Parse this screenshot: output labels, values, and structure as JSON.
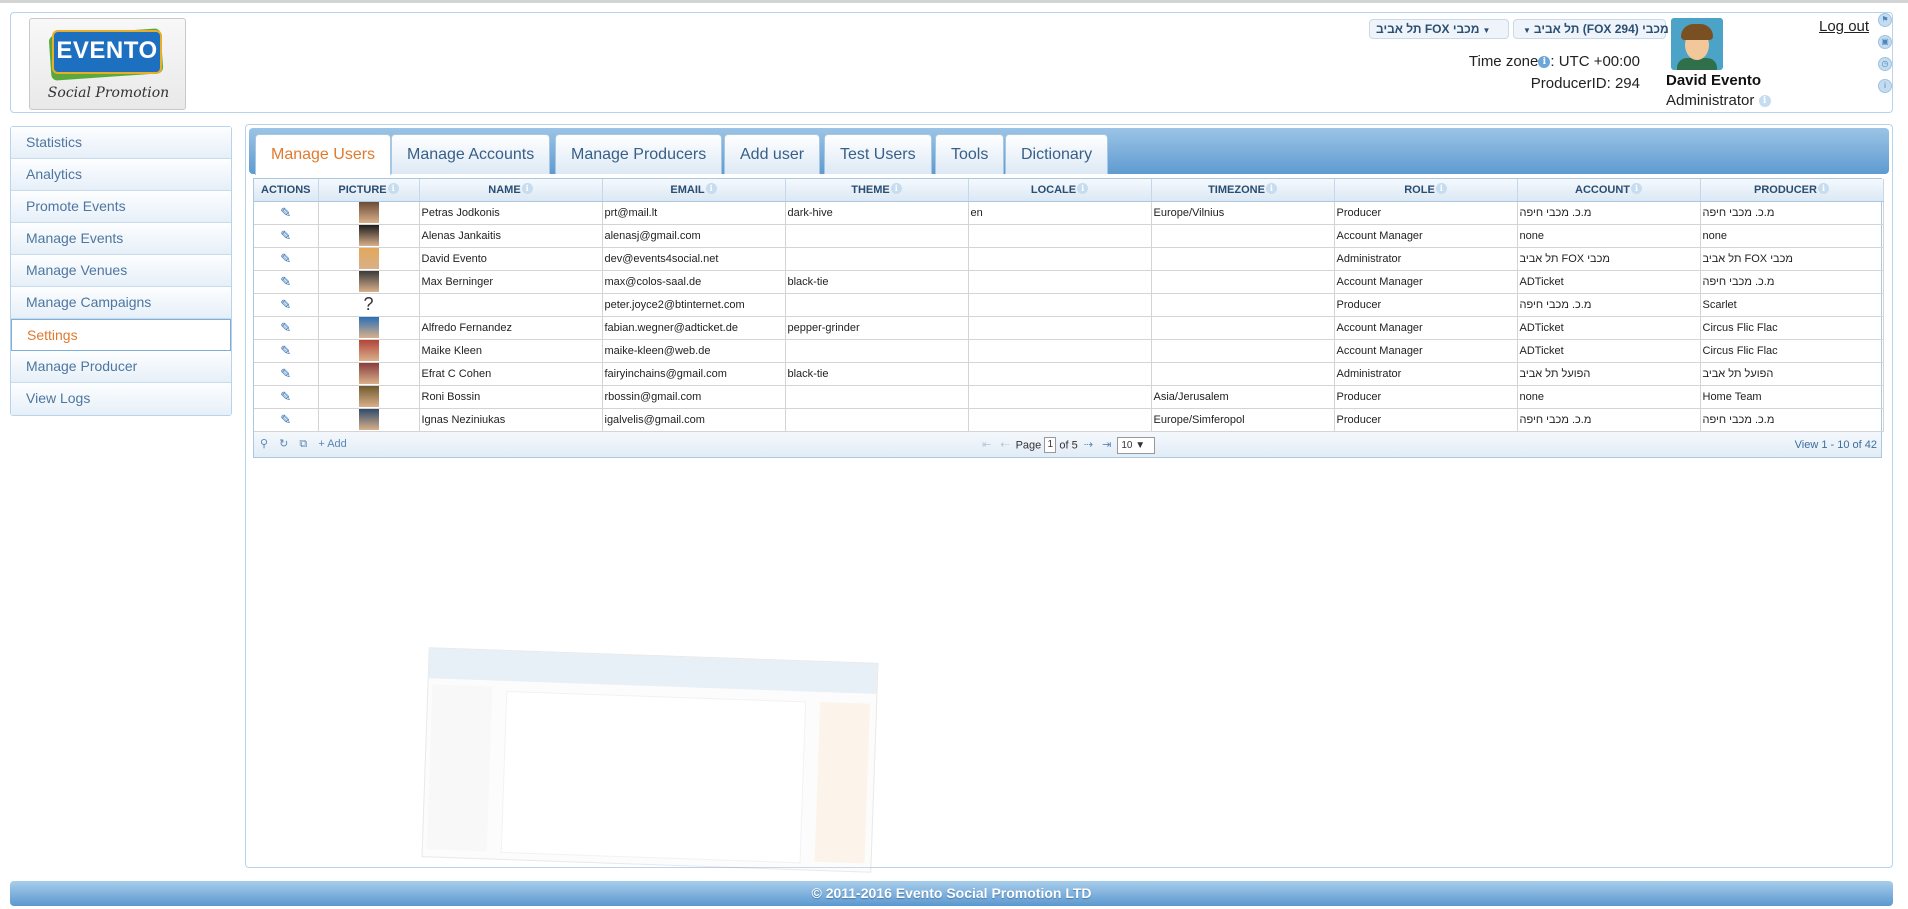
{
  "header": {
    "logo": {
      "title": "EVENTO",
      "subtitle": "Social Promotion"
    },
    "producer_select": "תל אביב (FOX 294) מכבי",
    "account_select": "תל אביב FOX מכבי",
    "timezone_label": "Time zone",
    "timezone_value": ": UTC +00:00",
    "producer_id": "ProducerID: 294",
    "user_name": "David Evento",
    "user_role": "Administrator",
    "logout": "Log out"
  },
  "nav": {
    "items": [
      {
        "label": "Statistics"
      },
      {
        "label": "Analytics"
      },
      {
        "label": "Promote Events"
      },
      {
        "label": "Manage Events"
      },
      {
        "label": "Manage Venues"
      },
      {
        "label": "Manage Campaigns"
      },
      {
        "label": "Settings",
        "active": true
      },
      {
        "label": "Manage Producer"
      },
      {
        "label": "View Logs"
      }
    ]
  },
  "tabs": [
    {
      "label": "Manage Users",
      "active": true
    },
    {
      "label": "Manage Accounts"
    },
    {
      "label": "Manage Producers"
    },
    {
      "label": "Add user"
    },
    {
      "label": "Test Users"
    },
    {
      "label": "Tools"
    },
    {
      "label": "Dictionary"
    }
  ],
  "table": {
    "columns": [
      "ACTIONS",
      "PICTURE",
      "NAME",
      "EMAIL",
      "THEME",
      "LOCALE",
      "TIMEZONE",
      "ROLE",
      "ACCOUNT",
      "PRODUCER"
    ],
    "rows": [
      {
        "name": "Petras Jodkonis",
        "email": "prt@mail.lt",
        "theme": "dark-hive",
        "locale": "en",
        "timezone": "Europe/Vilnius",
        "role": "Producer",
        "account": "מ.כ. מכבי חיפה",
        "producer": "מ.כ. מכבי חיפה",
        "pic": "#6b4b35"
      },
      {
        "name": "Alenas Jankaitis",
        "email": "alenasj@gmail.com",
        "theme": "",
        "locale": "",
        "timezone": "",
        "role": "Account Manager",
        "account": "none",
        "producer": "none",
        "pic": "#1d1d1d"
      },
      {
        "name": "David Evento",
        "email": "dev@events4social.net",
        "theme": "",
        "locale": "",
        "timezone": "",
        "role": "Administrator",
        "account": "תל אביב FOX מכבי",
        "producer": "תל אביב FOX מכבי",
        "pic": "#e2a85a"
      },
      {
        "name": "Max Berninger",
        "email": "max@colos-saal.de",
        "theme": "black-tie",
        "locale": "",
        "timezone": "",
        "role": "Account Manager",
        "account": "ADTicket",
        "producer": "מ.כ. מכבי חיפה",
        "pic": "#3a3a3a"
      },
      {
        "name": "",
        "email": "peter.joyce2@btinternet.com",
        "theme": "",
        "locale": "",
        "timezone": "",
        "role": "Producer",
        "account": "מ.כ. מכבי חיפה",
        "producer": "Scarlet",
        "pic": "?"
      },
      {
        "name": "Alfredo Fernandez",
        "email": "fabian.wegner@adticket.de",
        "theme": "pepper-grinder",
        "locale": "",
        "timezone": "",
        "role": "Account Manager",
        "account": "ADTicket",
        "producer": "Circus Flic Flac",
        "pic": "#2a6fb5"
      },
      {
        "name": "Maike Kleen",
        "email": "maike-kleen@web.de",
        "theme": "",
        "locale": "",
        "timezone": "",
        "role": "Account Manager",
        "account": "ADTicket",
        "producer": "Circus Flic Flac",
        "pic": "#b2453a"
      },
      {
        "name": "Efrat C Cohen",
        "email": "fairyinchains@gmail.com",
        "theme": "black-tie",
        "locale": "",
        "timezone": "",
        "role": "Administrator",
        "account": "הפועל תל אביב",
        "producer": "הפועל תל אביב",
        "pic": "#8a3d3d"
      },
      {
        "name": "Roni Bossin",
        "email": "rbossin@gmail.com",
        "theme": "",
        "locale": "",
        "timezone": "Asia/Jerusalem",
        "role": "Producer",
        "account": "none",
        "producer": "Home Team",
        "pic": "#6f5a2e"
      },
      {
        "name": "Ignas Neziniukas",
        "email": "igalvelis@gmail.com",
        "theme": "",
        "locale": "",
        "timezone": "Europe/Simferopol",
        "role": "Producer",
        "account": "מ.כ. מכבי חיפה",
        "producer": "מ.כ. מכבי חיפה",
        "pic": "#2f4b6a"
      }
    ]
  },
  "pager": {
    "add_label": "Add",
    "page_label": "Page",
    "page_value": "1",
    "of_label": "of 5",
    "rows_value": "10",
    "view_info": "View 1 - 10 of 42"
  },
  "footer": {
    "text": "© 2011-2016 Evento Social Promotion LTD"
  },
  "colors": {
    "accent": "#e07a2e",
    "nav_text": "#4d76a0",
    "tab_bar": "#5e9bd0"
  }
}
